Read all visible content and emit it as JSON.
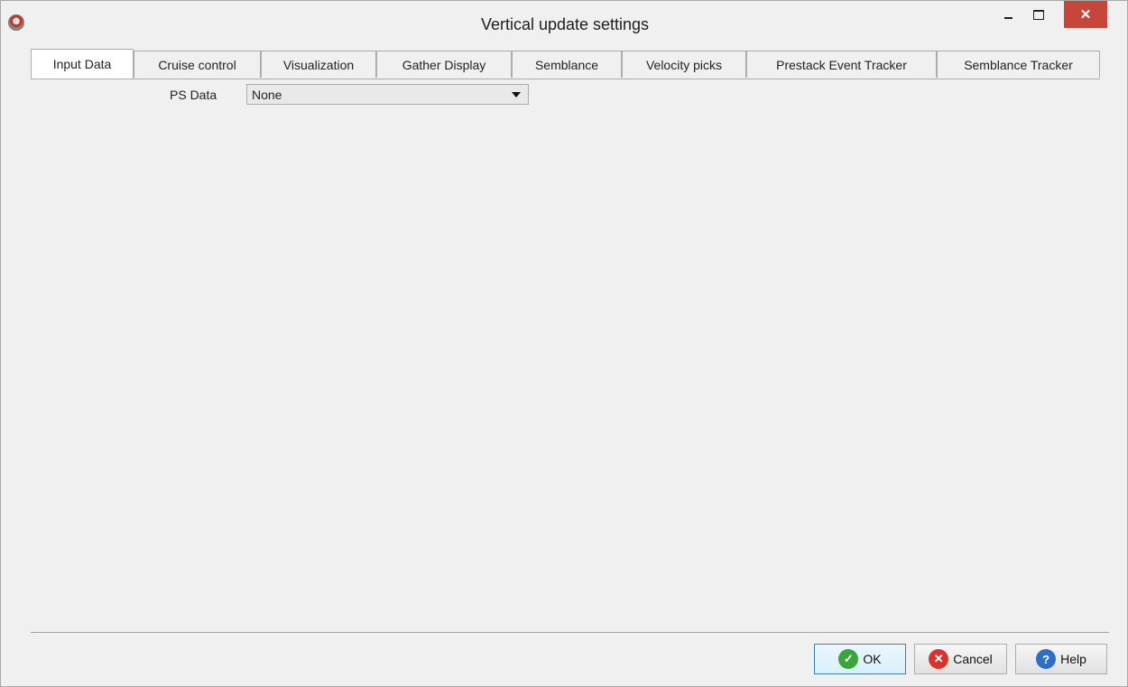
{
  "window": {
    "title": "Vertical update settings"
  },
  "tabs": [
    {
      "label": "Input Data",
      "active": true
    },
    {
      "label": "Cruise control"
    },
    {
      "label": "Visualization"
    },
    {
      "label": "Gather Display"
    },
    {
      "label": "Semblance"
    },
    {
      "label": "Velocity picks"
    },
    {
      "label": "Prestack Event Tracker"
    },
    {
      "label": "Semblance Tracker"
    }
  ],
  "input_data": {
    "ps_data_label": "PS Data",
    "ps_data_value": "None"
  },
  "buttons": {
    "ok": "OK",
    "cancel": "Cancel",
    "help": "Help"
  },
  "colors": {
    "close_button": "#c7463a",
    "background": "#f0f0f0"
  }
}
